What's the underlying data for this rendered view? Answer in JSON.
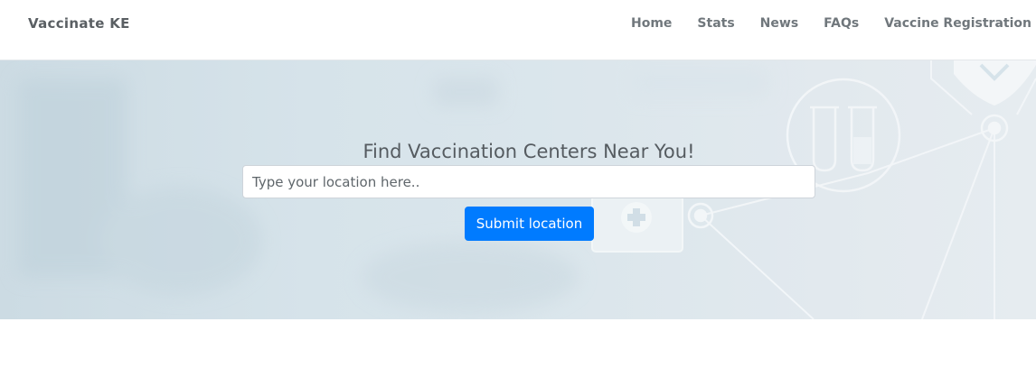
{
  "navbar": {
    "brand": "Vaccinate KE",
    "links": [
      {
        "label": "Home"
      },
      {
        "label": "Stats"
      },
      {
        "label": "News"
      },
      {
        "label": "FAQs"
      },
      {
        "label": "Vaccine Registration"
      }
    ]
  },
  "hero": {
    "title": "Find Vaccination Centers Near You!",
    "search": {
      "placeholder": "Type your location here..",
      "value": ""
    },
    "submit_label": "Submit location"
  },
  "colors": {
    "accent": "#007bff",
    "nav_text": "#70777c",
    "brand_text": "#5a5f63",
    "hero_bg": "#d6e3ea"
  },
  "icons": [
    "test-tubes-icon",
    "first-aid-kit-icon",
    "shield-icon",
    "network-node-icon"
  ]
}
